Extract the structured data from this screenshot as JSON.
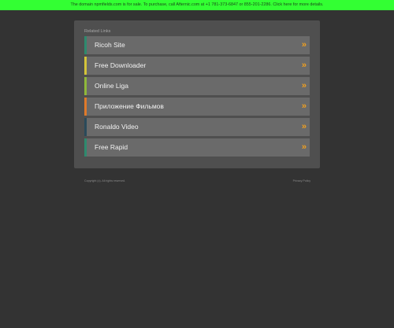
{
  "banner": {
    "text": "The domain npmfields.com is for sale. To purchase, call Afternic.com at +1 781-373-6847 or 855-201-2286. Click here for more details."
  },
  "panel": {
    "heading": "Related Links",
    "items": [
      {
        "label": "Ricoh Site",
        "color": "#2e8a6e"
      },
      {
        "label": "Free Downloader",
        "color": "#d4c43a"
      },
      {
        "label": "Online Liga",
        "color": "#8fb83a"
      },
      {
        "label": "Приложение Фильмов",
        "color": "#e07a2a"
      },
      {
        "label": "Ronaldo Video",
        "color": "#2a4a5a"
      },
      {
        "label": "Free Rapid",
        "color": "#2e8a6e"
      }
    ],
    "arrow_icon": "»"
  },
  "footer": {
    "copyright": "Copyright (c). All rights reserved.",
    "privacy": "Privacy Policy"
  }
}
